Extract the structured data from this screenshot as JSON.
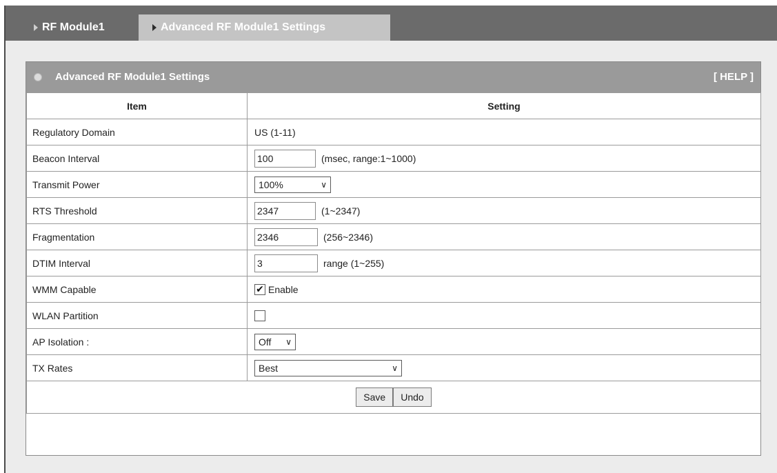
{
  "tabs": {
    "rf_module": "RF Module1",
    "advanced": "Advanced RF Module1 Settings"
  },
  "panel": {
    "title": "Advanced RF Module1 Settings",
    "help": "[ HELP ]"
  },
  "table": {
    "headers": {
      "item": "Item",
      "setting": "Setting"
    },
    "rows": {
      "regulatory_domain": {
        "label": "Regulatory Domain",
        "value": "US (1-11)"
      },
      "beacon_interval": {
        "label": "Beacon Interval",
        "value": "100",
        "hint": "(msec, range:1~1000)"
      },
      "transmit_power": {
        "label": "Transmit Power",
        "selected": "100%"
      },
      "rts_threshold": {
        "label": "RTS Threshold",
        "value": "2347",
        "hint": "(1~2347)"
      },
      "fragmentation": {
        "label": "Fragmentation",
        "value": "2346",
        "hint": "(256~2346)"
      },
      "dtim_interval": {
        "label": "DTIM Interval",
        "value": "3",
        "hint": "range (1~255)"
      },
      "wmm_capable": {
        "label": "WMM Capable",
        "checkbox_label": "Enable",
        "checked": true
      },
      "wlan_partition": {
        "label": "WLAN Partition",
        "checked": false
      },
      "ap_isolation": {
        "label": "AP Isolation :",
        "selected": "Off"
      },
      "tx_rates": {
        "label": "TX Rates",
        "selected": "Best"
      }
    }
  },
  "buttons": {
    "save": "Save",
    "undo": "Undo"
  },
  "icons": {
    "chevron": "chevron-down-icon",
    "tab_arrow": "tab-arrow-icon",
    "bullet": "panel-bullet-icon",
    "checkmark": "checkmark-icon"
  },
  "colors": {
    "topbar": "#6b6b6b",
    "active_tab": "#c4c4c4",
    "panel_header": "#9a9a9a",
    "content_bg": "#ececec"
  }
}
